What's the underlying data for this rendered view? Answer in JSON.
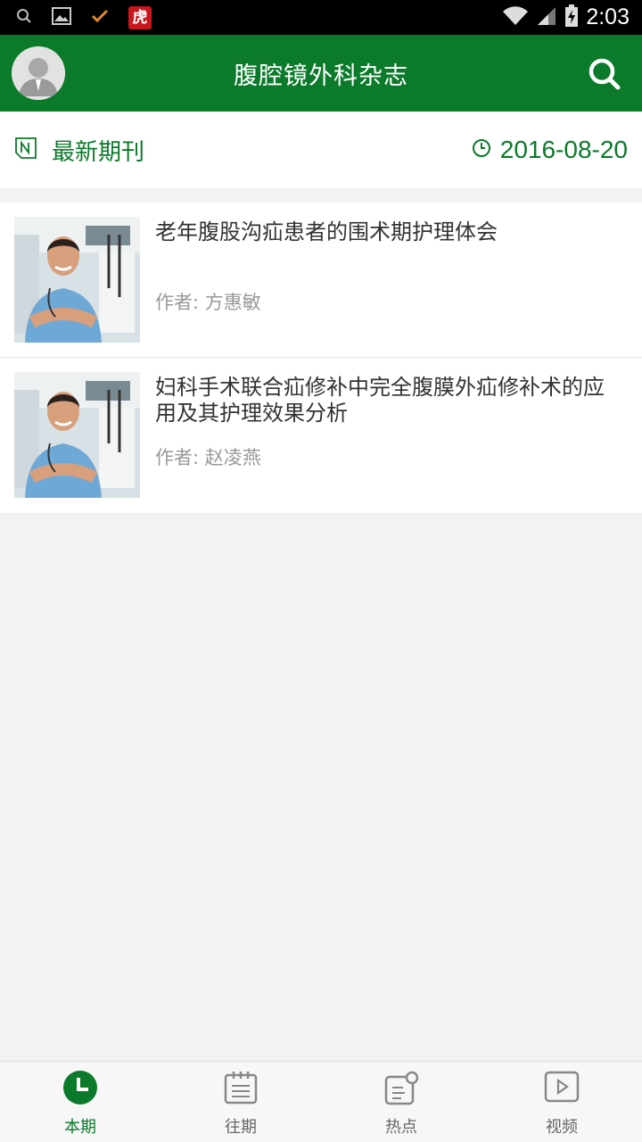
{
  "status_bar": {
    "time": "2:03",
    "left_icons": [
      "search-icon",
      "image-icon",
      "check-icon",
      "app-badge-icon"
    ],
    "app_badge_text": "虎",
    "right_icons": [
      "wifi-icon",
      "signal-icon",
      "battery-icon"
    ]
  },
  "header": {
    "title": "腹腔镜外科杂志",
    "avatar_icon": "user-avatar-icon",
    "search_icon": "search-icon",
    "color": "#0b7a2a"
  },
  "section": {
    "title": "最新期刊",
    "date": "2016-08-20",
    "icon": "journal-icon",
    "date_icon": "clock-icon"
  },
  "articles": [
    {
      "title": "老年腹股沟疝患者的围术期护理体会",
      "author": "作者: 方惠敏",
      "thumbnail_icon": "doctor-photo"
    },
    {
      "title": "妇科手术联合疝修补中完全腹膜外疝修补术的应用及其护理效果分析",
      "author": "作者: 赵凌燕",
      "thumbnail_icon": "doctor-photo"
    }
  ],
  "bottom_nav": {
    "items": [
      {
        "label": "本期",
        "icon": "clock-icon",
        "active": true
      },
      {
        "label": "往期",
        "icon": "calendar-icon",
        "active": false
      },
      {
        "label": "热点",
        "icon": "hot-notes-icon",
        "active": false
      },
      {
        "label": "视频",
        "icon": "video-play-icon",
        "active": false
      }
    ],
    "active_color": "#0b7a2a"
  }
}
